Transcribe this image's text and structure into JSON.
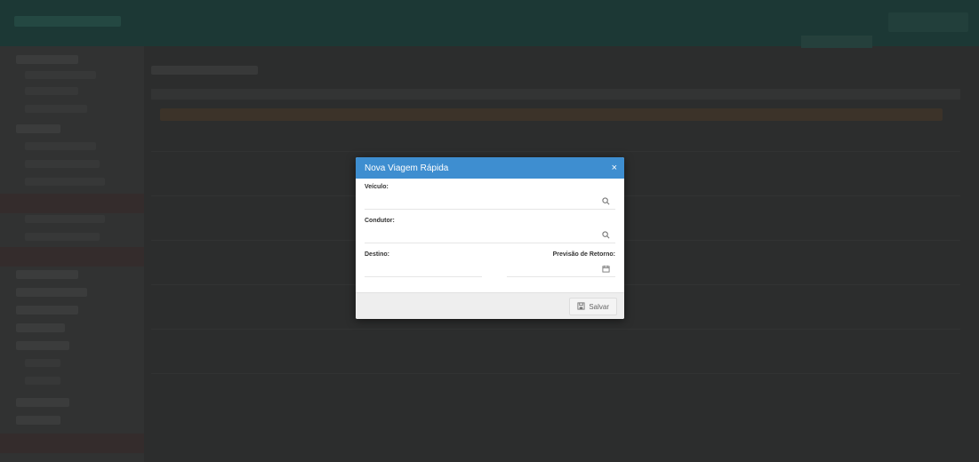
{
  "modal": {
    "title": "Nova Viagem Rápida",
    "close_icon": "×",
    "fields": {
      "veiculo": {
        "label": "Veículo:",
        "value": "",
        "icon": "search-icon"
      },
      "condutor": {
        "label": "Condutor:",
        "value": "",
        "icon": "search-icon"
      },
      "destino": {
        "label": "Destino:",
        "value": ""
      },
      "previsao_retorno": {
        "label": "Previsão de Retorno:",
        "value": "",
        "icon": "calendar-icon"
      }
    },
    "save_label": "Salvar",
    "colors": {
      "header": "#3e8ed0",
      "footer": "#eeeeee"
    }
  }
}
